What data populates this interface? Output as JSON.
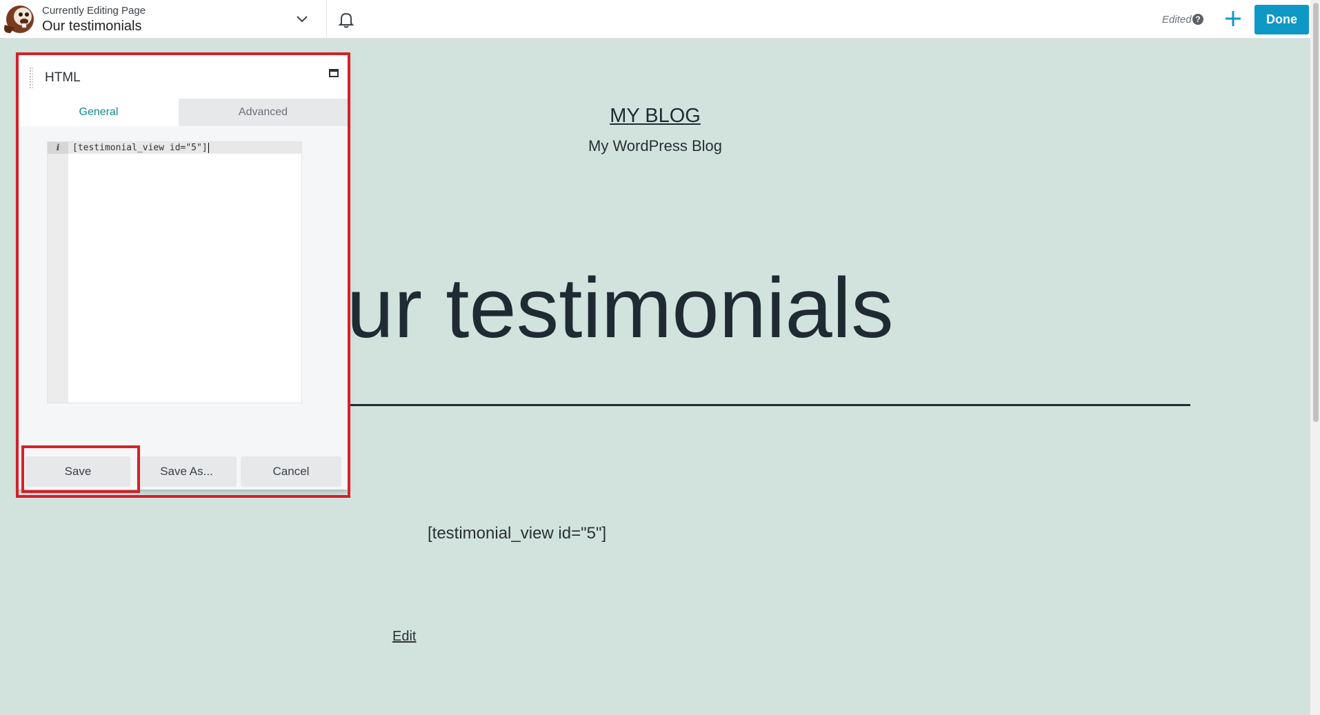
{
  "topbar": {
    "editing_label": "Currently Editing Page",
    "page_title": "Our testimonials",
    "status": "Edited",
    "help_glyph": "?",
    "done_label": "Done",
    "accent_color": "#0d98c6"
  },
  "page": {
    "blog_title": "MY BLOG",
    "tagline": "My WordPress Blog",
    "hero_text": "Our testimonials",
    "shortcode_output": "[testimonial_view id=\"5\"]",
    "edit_link": "Edit",
    "background_color": "#d2e3de"
  },
  "panel": {
    "title": "HTML",
    "tabs": [
      {
        "label": "General",
        "active": true
      },
      {
        "label": "Advanced",
        "active": false
      }
    ],
    "editor": {
      "gutter_marker": "i",
      "code": "[testimonial_view id=\"5\"]"
    },
    "buttons": {
      "save": "Save",
      "save_as": "Save As...",
      "cancel": "Cancel"
    }
  },
  "icons": [
    "beaver-logo-icon",
    "chevron-down-icon",
    "bell-icon",
    "help-icon",
    "plus-icon",
    "grip-icon",
    "maximize-icon"
  ],
  "highlight_color": "#d4202a"
}
